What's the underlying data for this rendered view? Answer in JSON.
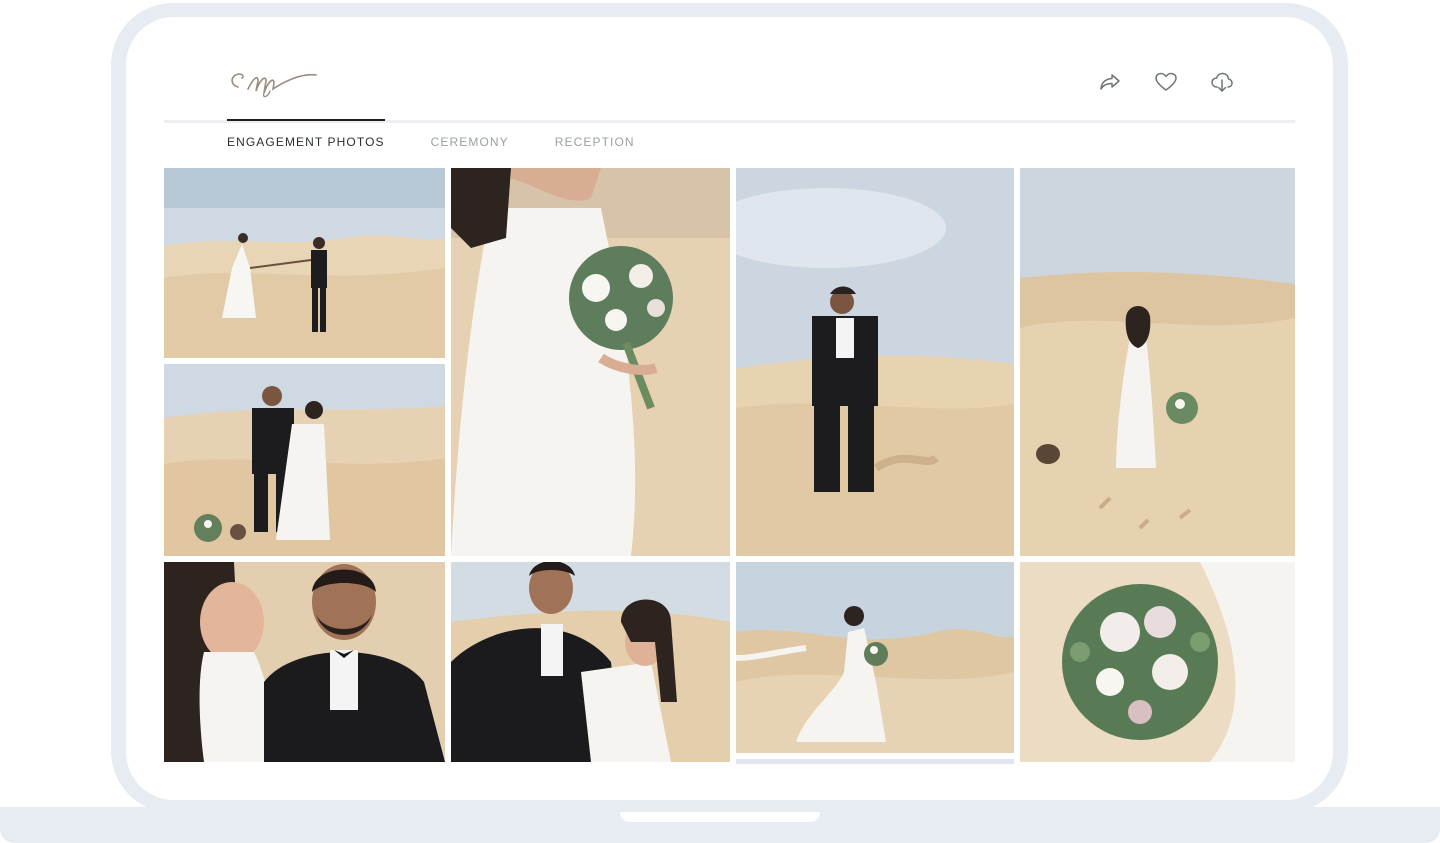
{
  "logo": {
    "text": "cm"
  },
  "header": {
    "actions": [
      {
        "name": "share-icon",
        "label": "Share"
      },
      {
        "name": "heart-icon",
        "label": "Favorite"
      },
      {
        "name": "download-icon",
        "label": "Download"
      }
    ]
  },
  "tabs": [
    {
      "label": "ENGAGEMENT PHOTOS",
      "active": true
    },
    {
      "label": "CEREMONY",
      "active": false
    },
    {
      "label": "RECEPTION",
      "active": false
    }
  ],
  "colors": {
    "frame": "#e7ecf2",
    "sky": "#cfd9e4",
    "sand": "#e8d3b3",
    "tab_active": "#2b2f33",
    "tab_inactive": "#9aa0a6"
  },
  "gallery": {
    "photos": [
      {
        "id": "p1",
        "subject": "couple walking hand in hand on dunes"
      },
      {
        "id": "p2",
        "subject": "bride holding bouquet close-up"
      },
      {
        "id": "p3",
        "subject": "groom standing on dune"
      },
      {
        "id": "p4",
        "subject": "bride walking away with bouquet"
      },
      {
        "id": "p5",
        "subject": "couple embracing on dunes"
      },
      {
        "id": "p6",
        "subject": "bride and groom smiling close-up"
      },
      {
        "id": "p7",
        "subject": "groom and bride laughing"
      },
      {
        "id": "p8",
        "subject": "bride with flowing dress on dune"
      },
      {
        "id": "p9",
        "subject": "bouquet detail"
      }
    ]
  }
}
